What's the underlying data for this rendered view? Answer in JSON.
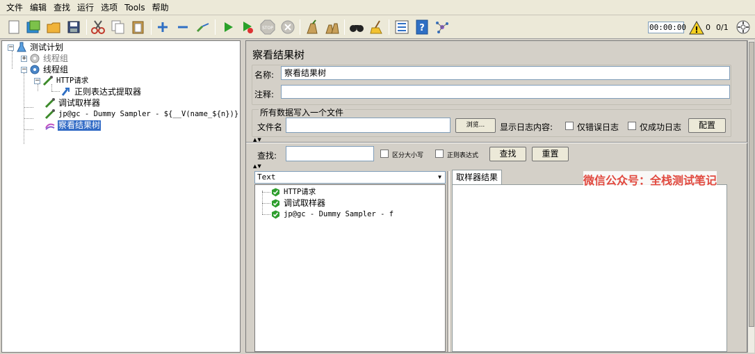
{
  "menubar": {
    "items": [
      "文件",
      "编辑",
      "查找",
      "运行",
      "选项",
      "Tools",
      "帮助"
    ]
  },
  "toolbar": {
    "buttons": [
      {
        "icon": "new-document-icon"
      },
      {
        "icon": "templates-icon"
      },
      {
        "icon": "open-folder-icon"
      },
      {
        "icon": "save-icon"
      },
      {
        "icon": "cut-icon"
      },
      {
        "icon": "copy-icon"
      },
      {
        "icon": "paste-icon"
      },
      {
        "icon": "expand-plus-icon"
      },
      {
        "icon": "collapse-minus-icon"
      },
      {
        "icon": "toggle-icon"
      },
      {
        "icon": "start-icon"
      },
      {
        "icon": "start-no-pauses-icon"
      },
      {
        "icon": "stop-icon"
      },
      {
        "icon": "shutdown-icon"
      },
      {
        "icon": "clear-icon"
      },
      {
        "icon": "clear-all-icon"
      },
      {
        "icon": "search-binoculars-icon"
      },
      {
        "icon": "reset-search-broom-icon"
      },
      {
        "icon": "function-helper-icon"
      },
      {
        "icon": "help-icon"
      },
      {
        "icon": "remote-icon"
      }
    ],
    "timer": "00:00:00",
    "warning_count": "0",
    "threads": "0/1",
    "status_icon": "warning-icon"
  },
  "tree": {
    "nodes": [
      {
        "label": "测试计划",
        "icon": "test-plan-icon"
      },
      {
        "label": "线程组",
        "icon": "thread-group-gear-icon",
        "disabled": true
      },
      {
        "label": "线程组",
        "icon": "thread-group-gear-icon"
      },
      {
        "label": "HTTP请求",
        "icon": "sampler-pipette-icon"
      },
      {
        "label": "正则表达式提取器",
        "icon": "post-processor-arrow-icon"
      },
      {
        "label": "调试取样器",
        "icon": "sampler-pipette-icon"
      },
      {
        "label": "jp@gc - Dummy Sampler - ${__V(name_${n})}",
        "icon": "sampler-pipette-icon"
      },
      {
        "label": "察看结果树",
        "icon": "listener-icon",
        "selected": true
      }
    ]
  },
  "panel": {
    "title": "察看结果树",
    "name_label": "名称:",
    "name_value": "察看结果树",
    "comment_label": "注释:",
    "comment_value": "",
    "file_group_title": "所有数据写入一个文件",
    "filename_label": "文件名",
    "filename_value": "",
    "browse_label": "浏览...",
    "log_content_label": "显示日志内容:",
    "errors_only_label": "仅错误日志",
    "success_only_label": "仅成功日志",
    "configure_label": "配置",
    "search_label": "查找:",
    "search_value": "",
    "case_sensitive_label": "区分大小写",
    "regex_label": "正则表达式",
    "search_button": "查找",
    "reset_button": "重置",
    "renderer_selected": "Text",
    "results": [
      {
        "label": "HTTP请求",
        "status": "success"
      },
      {
        "label": "调试取样器",
        "status": "success"
      },
      {
        "label": "jp@gc - Dummy Sampler - f",
        "status": "success"
      }
    ],
    "tab_label": "取样器结果"
  },
  "watermark": "微信公众号：全栈测试笔记",
  "colors": {
    "selection": "#316ac5",
    "success": "#2e9e2e",
    "watermark": "#e1493f"
  }
}
